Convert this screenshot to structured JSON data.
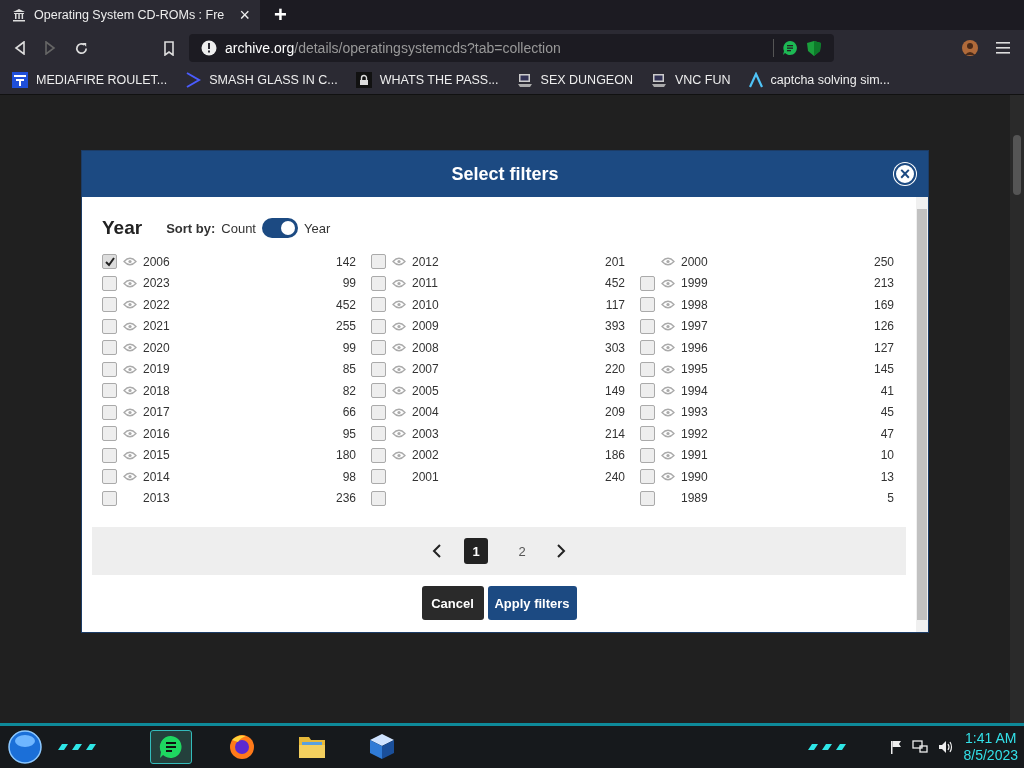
{
  "browser": {
    "tab_title": "Operating System CD-ROMs : Fre",
    "new_tab": "+",
    "close_tab": "×",
    "url_host": "archive.org",
    "url_path": "/details/operatingsystemcds?tab=collection",
    "bookmarks": [
      {
        "label": "MEDIAFIRE ROULET..."
      },
      {
        "label": "SMASH GLASS IN C..."
      },
      {
        "label": "WHATS THE PASS..."
      },
      {
        "label": "SEX DUNGEON"
      },
      {
        "label": "VNC FUN"
      },
      {
        "label": "captcha solving sim..."
      }
    ]
  },
  "modal": {
    "title": "Select filters",
    "close": "×",
    "heading": "Year",
    "sort_label": "Sort by:",
    "sort_left": "Count",
    "sort_right": "Year",
    "sort_by_year": true,
    "columns": [
      [
        {
          "kind": "full",
          "year": "2006",
          "count": "142",
          "checked": true,
          "eye": true
        },
        {
          "kind": "full",
          "year": "2023",
          "count": "99",
          "checked": false,
          "eye": true
        },
        {
          "kind": "full",
          "year": "2022",
          "count": "452",
          "checked": false,
          "eye": true
        },
        {
          "kind": "full",
          "year": "2021",
          "count": "255",
          "checked": false,
          "eye": true
        },
        {
          "kind": "full",
          "year": "2020",
          "count": "99",
          "checked": false,
          "eye": true
        },
        {
          "kind": "full",
          "year": "2019",
          "count": "85",
          "checked": false,
          "eye": true
        },
        {
          "kind": "full",
          "year": "2018",
          "count": "82",
          "checked": false,
          "eye": true
        },
        {
          "kind": "full",
          "year": "2017",
          "count": "66",
          "checked": false,
          "eye": true
        },
        {
          "kind": "full",
          "year": "2016",
          "count": "95",
          "checked": false,
          "eye": true
        },
        {
          "kind": "full",
          "year": "2015",
          "count": "180",
          "checked": false,
          "eye": true
        },
        {
          "kind": "full",
          "year": "2014",
          "count": "98",
          "checked": false,
          "eye": true
        },
        {
          "kind": "full",
          "year": "2013",
          "count": "236",
          "checked": false,
          "eye": false
        }
      ],
      [
        {
          "kind": "full",
          "year": "2012",
          "count": "201",
          "checked": false,
          "eye": true
        },
        {
          "kind": "full",
          "year": "2011",
          "count": "452",
          "checked": false,
          "eye": true
        },
        {
          "kind": "full",
          "year": "2010",
          "count": "117",
          "checked": false,
          "eye": true
        },
        {
          "kind": "full",
          "year": "2009",
          "count": "393",
          "checked": false,
          "eye": true
        },
        {
          "kind": "full",
          "year": "2008",
          "count": "303",
          "checked": false,
          "eye": true
        },
        {
          "kind": "full",
          "year": "2007",
          "count": "220",
          "checked": false,
          "eye": true
        },
        {
          "kind": "full",
          "year": "2005",
          "count": "149",
          "checked": false,
          "eye": true
        },
        {
          "kind": "full",
          "year": "2004",
          "count": "209",
          "checked": false,
          "eye": true
        },
        {
          "kind": "full",
          "year": "2003",
          "count": "214",
          "checked": false,
          "eye": true
        },
        {
          "kind": "full",
          "year": "2002",
          "count": "186",
          "checked": false,
          "eye": true
        },
        {
          "kind": "full",
          "year": "2001",
          "count": "240",
          "checked": false,
          "eye": false
        },
        {
          "kind": "checkbox",
          "checked": false
        }
      ],
      [
        {
          "kind": "label",
          "year": "2000",
          "count": "250",
          "eye": true
        },
        {
          "kind": "full",
          "year": "1999",
          "count": "213",
          "checked": false,
          "eye": true
        },
        {
          "kind": "full",
          "year": "1998",
          "count": "169",
          "checked": false,
          "eye": true
        },
        {
          "kind": "full",
          "year": "1997",
          "count": "126",
          "checked": false,
          "eye": true
        },
        {
          "kind": "full",
          "year": "1996",
          "count": "127",
          "checked": false,
          "eye": true
        },
        {
          "kind": "full",
          "year": "1995",
          "count": "145",
          "checked": false,
          "eye": true
        },
        {
          "kind": "full",
          "year": "1994",
          "count": "41",
          "checked": false,
          "eye": true
        },
        {
          "kind": "full",
          "year": "1993",
          "count": "45",
          "checked": false,
          "eye": true
        },
        {
          "kind": "full",
          "year": "1992",
          "count": "47",
          "checked": false,
          "eye": true
        },
        {
          "kind": "full",
          "year": "1991",
          "count": "10",
          "checked": false,
          "eye": true
        },
        {
          "kind": "full",
          "year": "1990",
          "count": "13",
          "checked": false,
          "eye": true
        },
        {
          "kind": "full",
          "year": "1989",
          "count": "5",
          "checked": false,
          "eye": false
        }
      ]
    ],
    "pages": [
      {
        "label": "1",
        "selected": true
      },
      {
        "label": "2",
        "selected": false
      }
    ],
    "cancel": "Cancel",
    "apply": "Apply filters"
  },
  "taskbar": {
    "apps": [
      {
        "selected": true
      },
      {
        "selected": false
      },
      {
        "selected": false
      },
      {
        "selected": false
      }
    ],
    "time": "1:41 AM",
    "date": "8/5/2023"
  }
}
